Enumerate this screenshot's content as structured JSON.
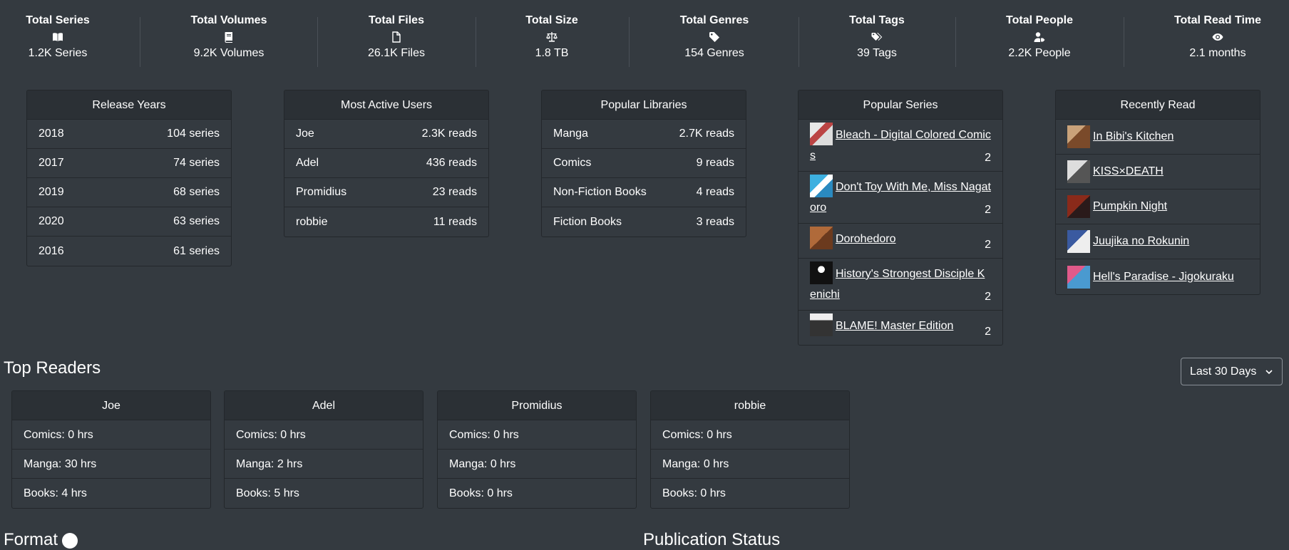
{
  "stats": [
    {
      "title": "Total Series",
      "icon": "book-open-icon",
      "value": "1.2K Series"
    },
    {
      "title": "Total Volumes",
      "icon": "book-icon",
      "value": "9.2K Volumes"
    },
    {
      "title": "Total Files",
      "icon": "file-icon",
      "value": "26.1K Files"
    },
    {
      "title": "Total Size",
      "icon": "scale-icon",
      "value": "1.8 TB"
    },
    {
      "title": "Total Genres",
      "icon": "tag-icon",
      "value": "154 Genres"
    },
    {
      "title": "Total Tags",
      "icon": "tags-icon",
      "value": "39 Tags"
    },
    {
      "title": "Total People",
      "icon": "user-tag-icon",
      "value": "2.2K People"
    },
    {
      "title": "Total Read Time",
      "icon": "eye-icon",
      "value": "2.1 months"
    }
  ],
  "release_years": {
    "title": "Release Years",
    "rows": [
      {
        "label": "2018",
        "value": "104 series"
      },
      {
        "label": "2017",
        "value": "74 series"
      },
      {
        "label": "2019",
        "value": "68 series"
      },
      {
        "label": "2020",
        "value": "63 series"
      },
      {
        "label": "2016",
        "value": "61 series"
      }
    ]
  },
  "active_users": {
    "title": "Most Active Users",
    "rows": [
      {
        "label": "Joe",
        "value": "2.3K reads"
      },
      {
        "label": "Adel",
        "value": "436 reads"
      },
      {
        "label": "Promidius",
        "value": "23 reads"
      },
      {
        "label": "robbie",
        "value": "11 reads"
      }
    ]
  },
  "popular_libraries": {
    "title": "Popular Libraries",
    "rows": [
      {
        "label": "Manga",
        "value": "2.7K reads"
      },
      {
        "label": "Comics",
        "value": "9 reads"
      },
      {
        "label": "Non-Fiction Books",
        "value": "4 reads"
      },
      {
        "label": "Fiction Books",
        "value": "3 reads"
      }
    ]
  },
  "popular_series": {
    "title": "Popular Series",
    "rows": [
      {
        "label": "Bleach - Digital Colored Comics",
        "value": "2"
      },
      {
        "label": "Don't Toy With Me, Miss Nagatoro",
        "value": "2"
      },
      {
        "label": "Dorohedoro",
        "value": "2"
      },
      {
        "label": "History's Strongest Disciple Kenichi",
        "value": "2"
      },
      {
        "label": "BLAME! Master Edition",
        "value": "2"
      }
    ]
  },
  "recently_read": {
    "title": "Recently Read",
    "rows": [
      {
        "label": "In Bibi's Kitchen"
      },
      {
        "label": "KISS×DEATH"
      },
      {
        "label": "Pumpkin Night"
      },
      {
        "label": "Juujika no Rokunin"
      },
      {
        "label": "Hell's Paradise - Jigokuraku"
      }
    ]
  },
  "top_readers": {
    "title": "Top Readers",
    "range_selected": "Last 30 Days",
    "readers": [
      {
        "name": "Joe",
        "comics": "Comics: 0 hrs",
        "manga": "Manga: 30 hrs",
        "books": "Books: 4 hrs"
      },
      {
        "name": "Adel",
        "comics": "Comics: 0 hrs",
        "manga": "Manga: 2 hrs",
        "books": "Books: 5 hrs"
      },
      {
        "name": "Promidius",
        "comics": "Comics: 0 hrs",
        "manga": "Manga: 0 hrs",
        "books": "Books: 0 hrs"
      },
      {
        "name": "robbie",
        "comics": "Comics: 0 hrs",
        "manga": "Manga: 0 hrs",
        "books": "Books: 0 hrs"
      }
    ]
  },
  "bottom_sections": {
    "format_title": "Format",
    "publication_title": "Publication Status"
  },
  "colors": {
    "background": "#343a40",
    "card_header": "#2b3035",
    "border": "#23272b"
  }
}
